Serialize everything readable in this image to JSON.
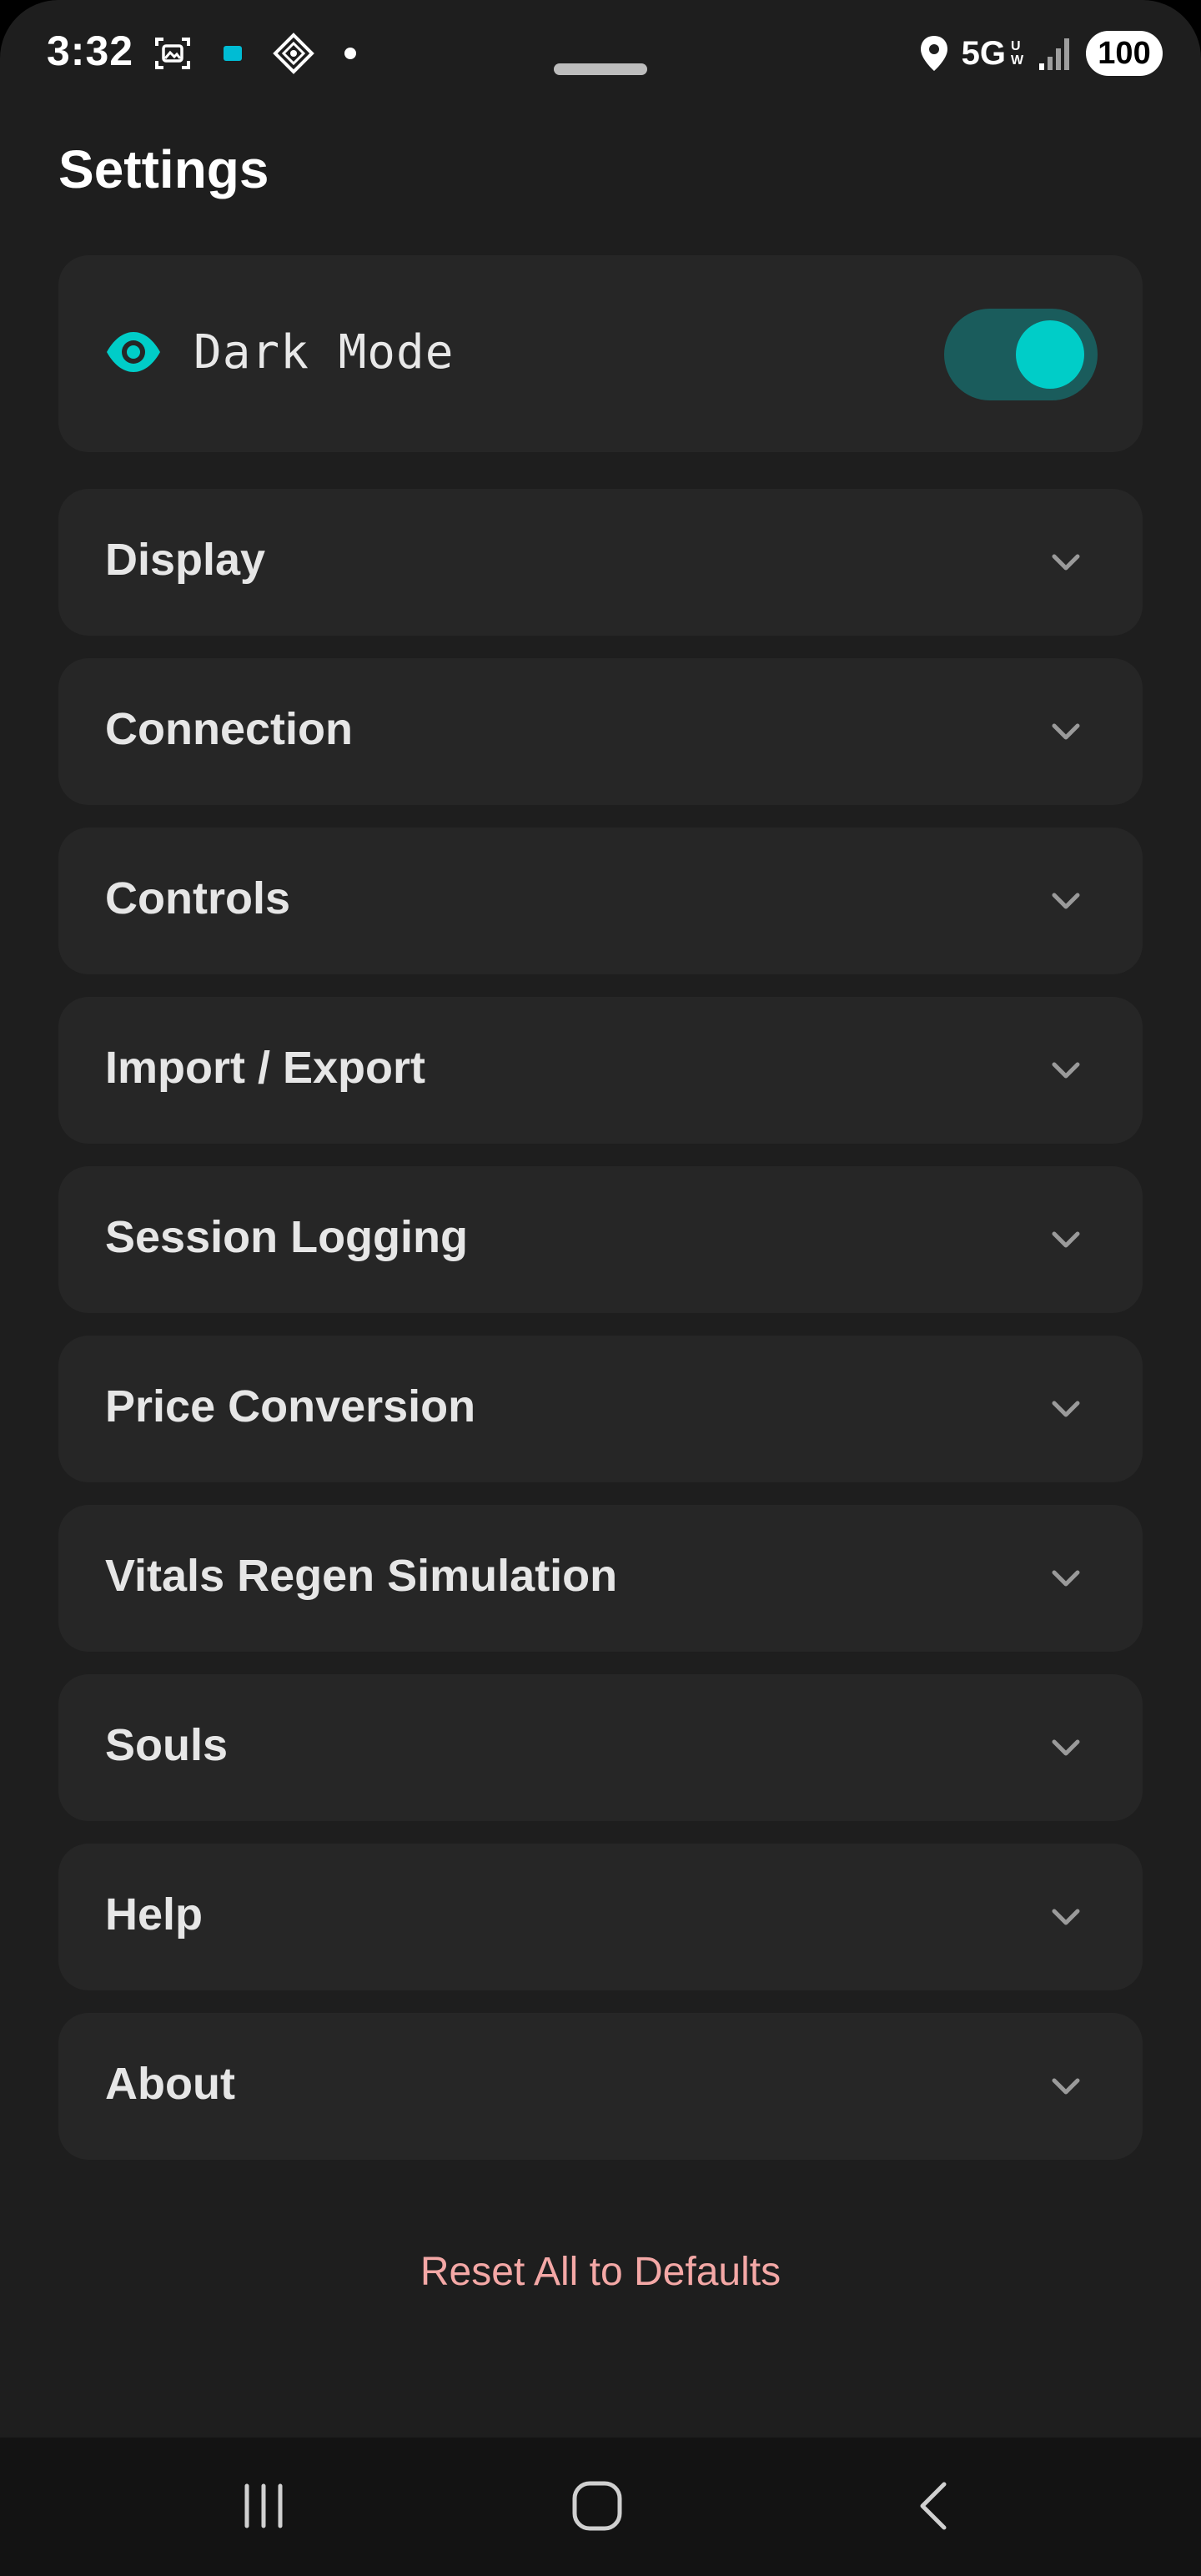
{
  "status_bar": {
    "time": "3:32",
    "network": "5G",
    "network_sub": "UW",
    "battery": "100"
  },
  "page": {
    "title": "Settings"
  },
  "dark_mode": {
    "label": "Dark Mode",
    "enabled": true,
    "accent_color": "#00cdc8"
  },
  "sections": [
    {
      "label": "Display"
    },
    {
      "label": "Connection"
    },
    {
      "label": "Controls"
    },
    {
      "label": "Import / Export"
    },
    {
      "label": "Session Logging"
    },
    {
      "label": "Price Conversion"
    },
    {
      "label": "Vitals Regen Simulation"
    },
    {
      "label": "Souls"
    },
    {
      "label": "Help"
    },
    {
      "label": "About"
    }
  ],
  "reset": {
    "label": "Reset All to Defaults"
  },
  "nav": {
    "recents_icon": "recents-icon",
    "home_icon": "home-icon",
    "back_icon": "back-icon"
  }
}
